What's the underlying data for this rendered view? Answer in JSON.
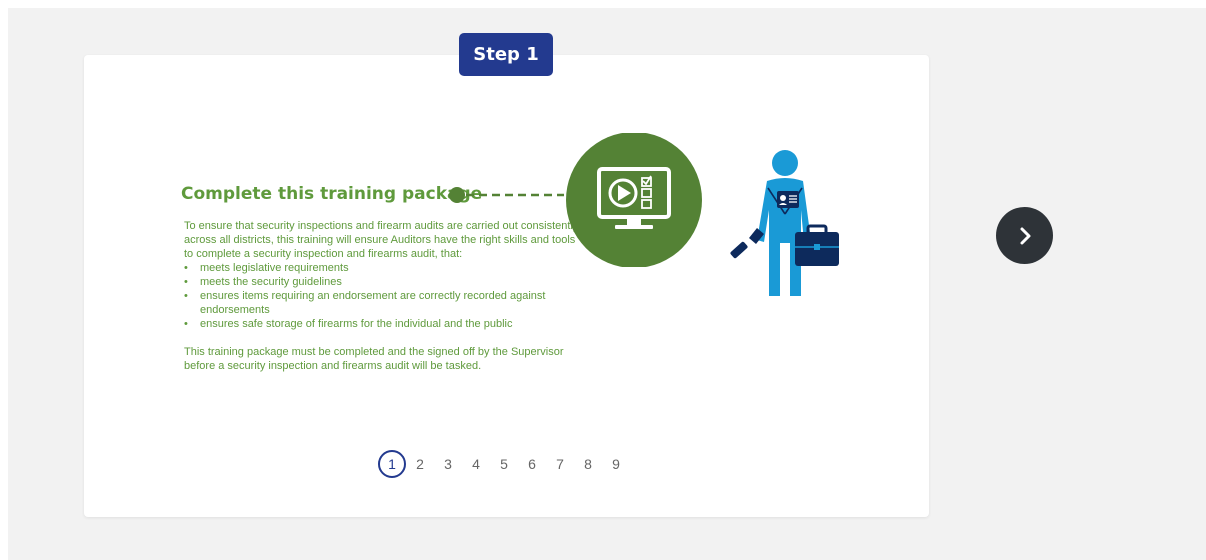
{
  "step_badge": {
    "label": "Step 1"
  },
  "content": {
    "title": "Complete this training package",
    "intro": "To ensure that security inspections and firearm audits are carried out consistently across all districts, this training will ensure Auditors have the right skills and tools to complete a security inspection and firearms audit, that:",
    "bullets": [
      "meets legislative requirements",
      "meets the security guidelines",
      "ensures items requiring an endorsement are correctly recorded against endorsements",
      "ensures safe storage of firearms for the individual and the public"
    ],
    "closing": "This training package must be completed and the signed off by the Supervisor before a security inspection and firearms audit will be tasked."
  },
  "illustration": {
    "monitor_icon": "video-checklist-monitor-icon",
    "person_icon": "auditor-with-flashlight-and-briefcase-icon"
  },
  "pagination": {
    "pages": [
      "1",
      "2",
      "3",
      "4",
      "5",
      "6",
      "7",
      "8",
      "9"
    ],
    "current": 1
  },
  "navigation": {
    "next_icon": "chevron-right-icon"
  },
  "colors": {
    "accent_blue": "#233a8f",
    "green_text": "#5f9a3c",
    "green_circle": "#548235",
    "figure_blue": "#1a9ad6",
    "navy": "#0d2a5c",
    "next_button": "#2e3338",
    "background": "#f2f2f2"
  }
}
